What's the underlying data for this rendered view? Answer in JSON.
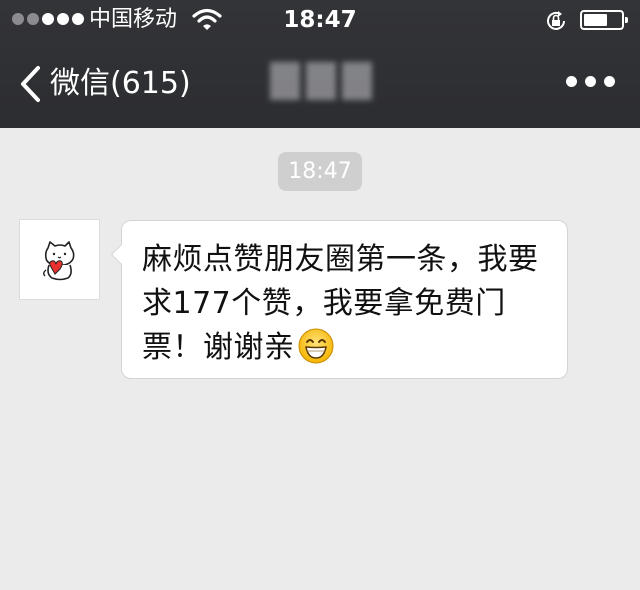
{
  "status_bar": {
    "carrier": "中国移动",
    "time": "18:47"
  },
  "nav": {
    "back_label": "微信(615)"
  },
  "chat": {
    "timestamp": "18:47",
    "message": "麻烦点赞朋友圈第一条，我要求177个赞，我要拿免费门票！谢谢亲",
    "message_emoji": "grinning-face-emoji"
  },
  "icons": {
    "back": "chevron-left-icon",
    "more": "more-dots-icon",
    "wifi": "wifi-icon",
    "rotation_lock": "rotation-lock-icon",
    "battery": "battery-icon",
    "avatar": "cat-holding-heart"
  },
  "colors": {
    "nav_bg": "#2f3034",
    "chat_bg": "#ebebeb",
    "bubble_bg": "#ffffff",
    "timestamp_bg": "#cfcfcf"
  },
  "battery_level": 0.58
}
